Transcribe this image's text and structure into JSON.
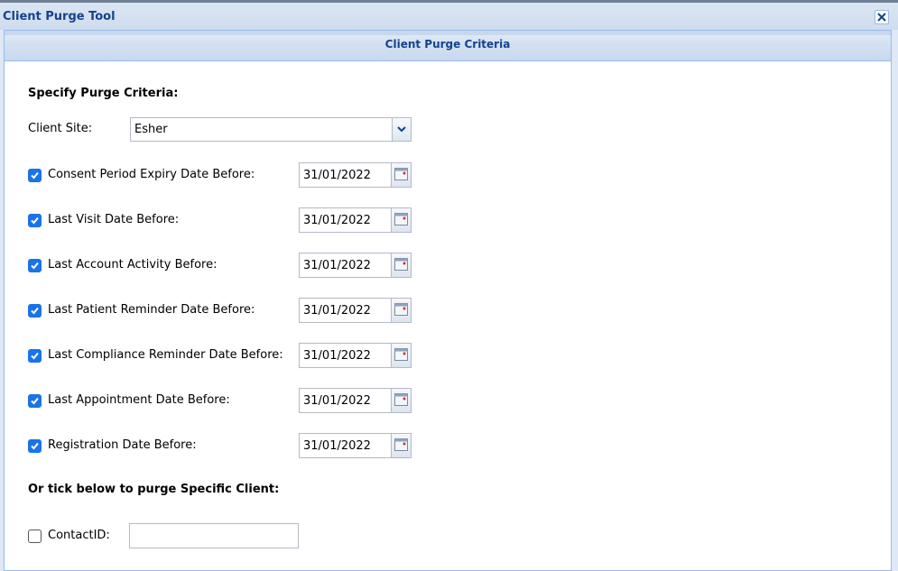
{
  "window": {
    "title": "Client Purge Tool"
  },
  "panel": {
    "title": "Client Purge Criteria"
  },
  "form": {
    "heading": "Specify Purge Criteria:",
    "client_site": {
      "label": "Client Site:",
      "value": "Esher"
    },
    "criteria": [
      {
        "label": "Consent Period Expiry Date Before:",
        "checked": true,
        "value": "31/01/2022"
      },
      {
        "label": "Last Visit Date Before:",
        "checked": true,
        "value": "31/01/2022"
      },
      {
        "label": "Last Account Activity Before:",
        "checked": true,
        "value": "31/01/2022"
      },
      {
        "label": "Last Patient Reminder Date Before:",
        "checked": true,
        "value": "31/01/2022"
      },
      {
        "label": "Last Compliance Reminder Date Before:",
        "checked": true,
        "value": "31/01/2022"
      },
      {
        "label": "Last Appointment Date Before:",
        "checked": true,
        "value": "31/01/2022"
      },
      {
        "label": "Registration Date Before:",
        "checked": true,
        "value": "31/01/2022"
      }
    ],
    "specific_heading": "Or tick below to purge Specific Client:",
    "contact": {
      "label": "ContactID:",
      "checked": false,
      "value": ""
    }
  },
  "icons": {
    "close": "close-icon",
    "dropdown": "chevron-down-icon",
    "calendar": "calendar-icon",
    "checkbox": "checkmark-icon"
  },
  "colors": {
    "title_text": "#15428b",
    "panel_border": "#99bbe8",
    "checkbox_checked": "#1a73e8",
    "header_bg": "#dfe8f6"
  }
}
